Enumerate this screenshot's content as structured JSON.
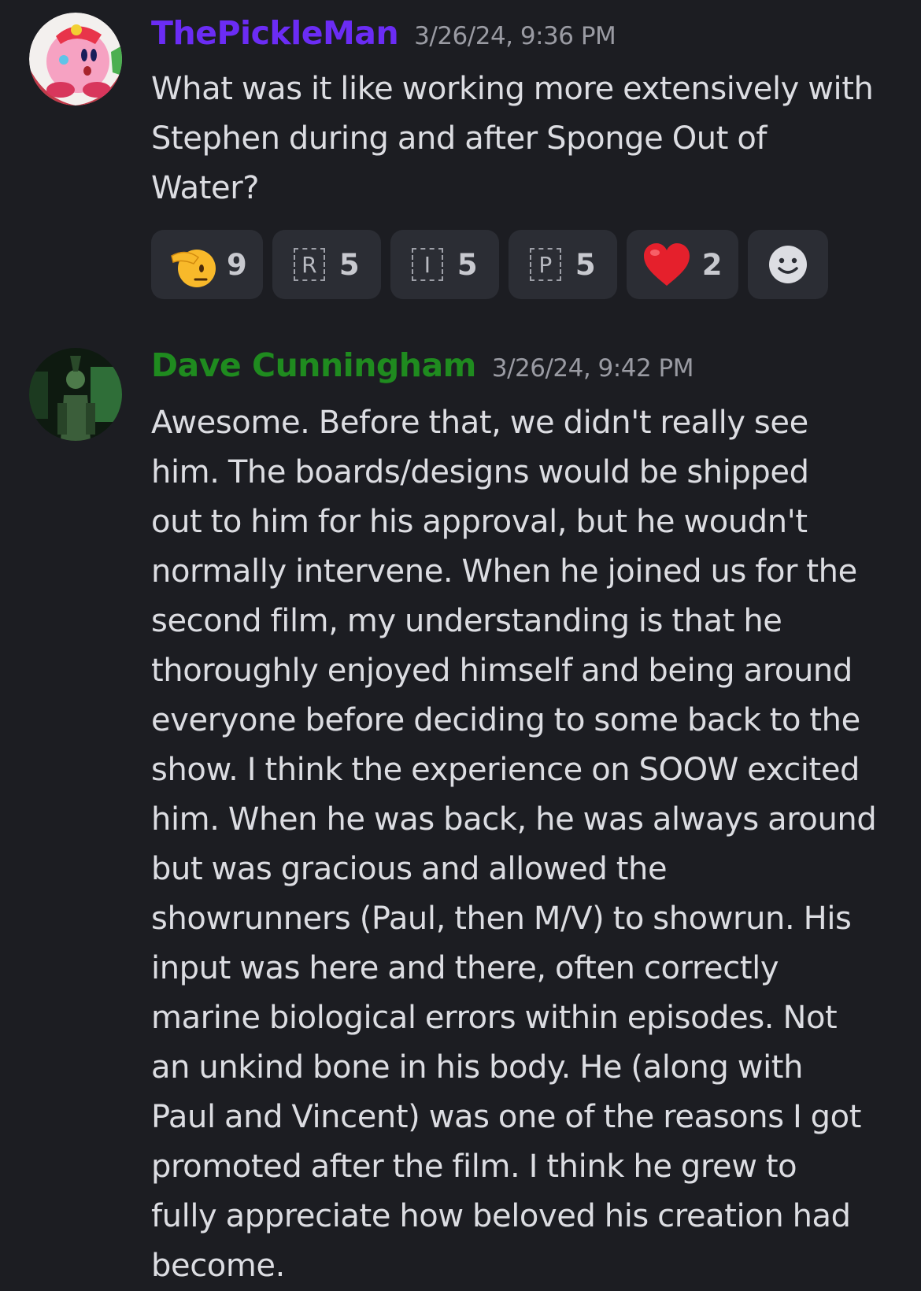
{
  "messages": [
    {
      "username": "ThePickleMan",
      "username_color": "#6b2cf5",
      "timestamp": "3/26/24, 9:36 PM",
      "lines": [
        "What was it like working more extensively with",
        "Stephen during and after Sponge Out of",
        "Water?"
      ],
      "reactions": [
        {
          "icon": "saluting-face-emoji",
          "count": "9"
        },
        {
          "icon": "regional-indicator-r",
          "letter": "R",
          "count": "5"
        },
        {
          "icon": "regional-indicator-i",
          "letter": "I",
          "count": "5"
        },
        {
          "icon": "regional-indicator-p",
          "letter": "P",
          "count": "5"
        },
        {
          "icon": "red-heart-emoji",
          "count": "2"
        },
        {
          "icon": "add-reaction-icon"
        }
      ]
    },
    {
      "username": "Dave Cunningham",
      "username_color": "#1f8b1f",
      "timestamp": "3/26/24, 9:42 PM",
      "lines": [
        "Awesome. Before that, we didn't really see",
        "him. The boards/designs would be shipped",
        "out to him for his approval, but he woudn't",
        "normally intervene. When he joined us for the",
        "second film, my understanding is that he",
        "thoroughly enjoyed himself and being around",
        "everyone before deciding to some back to the",
        "show. I think the experience on SOOW excited",
        "him. When he was back, he was always around",
        "but was gracious and allowed the",
        "showrunners (Paul, then M/V) to showrun. His",
        "input was here and there, often correctly",
        "marine biological errors within episodes. Not",
        "an unkind bone in his body. He (along with",
        "Paul and Vincent) was one of the reasons I got",
        "promoted after the film. I think he grew to",
        "fully appreciate how beloved his creation had",
        "become."
      ]
    }
  ]
}
